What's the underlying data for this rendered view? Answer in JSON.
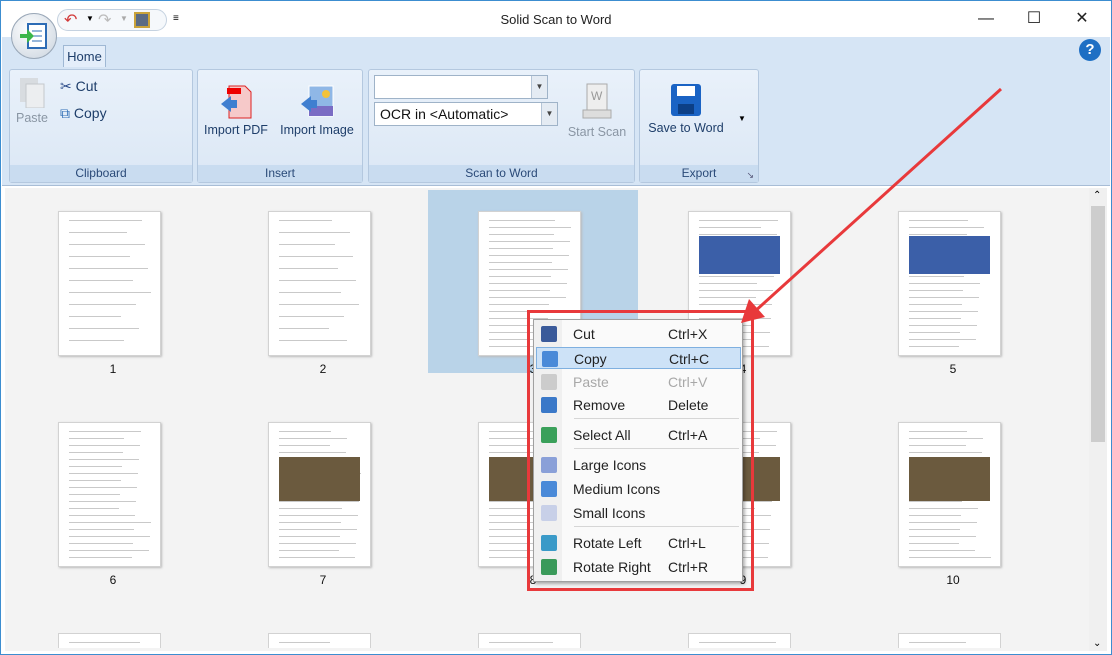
{
  "window": {
    "title": "Solid Scan to Word",
    "controls": [
      "minimize",
      "maximize",
      "close"
    ]
  },
  "qat": {
    "icons": [
      "undo-icon",
      "redo-icon",
      "save-icon"
    ]
  },
  "tabs": [
    {
      "label": "Home",
      "active": true
    }
  ],
  "ribbon": {
    "clipboard": {
      "label": "Clipboard",
      "paste": "Paste",
      "cut": "Cut",
      "copy": "Copy"
    },
    "insert": {
      "label": "Insert",
      "import_pdf": "Import PDF",
      "import_image": "Import Image"
    },
    "scan": {
      "label": "Scan to Word",
      "combo1_value": "",
      "ocr_value": "OCR in <Automatic>",
      "start_scan": "Start Scan"
    },
    "export": {
      "label": "Export",
      "save_to_word": "Save to Word"
    }
  },
  "pages": [
    {
      "n": "1"
    },
    {
      "n": "2"
    },
    {
      "n": "3",
      "selected": true
    },
    {
      "n": "4"
    },
    {
      "n": "5"
    },
    {
      "n": "6"
    },
    {
      "n": "7"
    },
    {
      "n": "8"
    },
    {
      "n": "9"
    },
    {
      "n": "10"
    },
    {
      "n": ""
    },
    {
      "n": ""
    },
    {
      "n": ""
    },
    {
      "n": ""
    },
    {
      "n": ""
    }
  ],
  "context_menu": {
    "items": [
      {
        "label": "Cut",
        "shortcut": "Ctrl+X"
      },
      {
        "label": "Copy",
        "shortcut": "Ctrl+C",
        "highlighted": true
      },
      {
        "label": "Paste",
        "shortcut": "Ctrl+V",
        "disabled": true
      },
      {
        "label": "Remove",
        "shortcut": "Delete"
      },
      {
        "label": "Select All",
        "shortcut": "Ctrl+A"
      },
      {
        "label": "Large Icons",
        "shortcut": ""
      },
      {
        "label": "Medium Icons",
        "shortcut": "",
        "checked": true
      },
      {
        "label": "Small Icons",
        "shortcut": ""
      },
      {
        "label": "Rotate Left",
        "shortcut": "Ctrl+L"
      },
      {
        "label": "Rotate Right",
        "shortcut": "Ctrl+R"
      }
    ]
  },
  "annotation_color": "#e8393b"
}
